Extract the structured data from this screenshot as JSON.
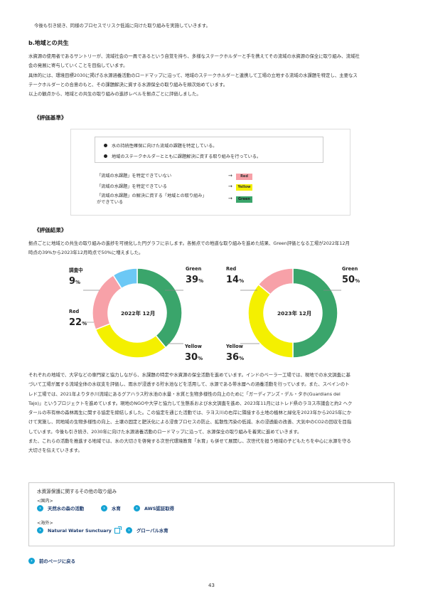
{
  "intro_text": "今後も引き続き、同様のプロセスでリスク低減に向けた取り組みを実施していきます。",
  "section_title": "b.地域との共生",
  "section_paragraph": [
    "水資源の使用者であるサントリーが、流域社会の一員であるという自覚を持ち、多様なステークホルダーと手を携えてその流域の水資源の保全に取り組み、流域社",
    "会の発展に寄与していくことを目指しています。",
    "具体的には、環境目標2030に掲げる水源涵養活動のロードマップに沿って、地域のステークホルダーと連携して工場の立地する流域の水課題を特定し、主要なス",
    "テークホルダーとの合意のもと、その課題解決に資する水源保全の取り組みを順次始めています。",
    "以上の観点から、地域との共生の取り組みの進捗レベルを拠点ごとに評価しました。"
  ],
  "criteria": {
    "heading": "《評価基準》",
    "bullets": [
      "水の持続性確保に向けた流域の課題を特定している。",
      "地域のステークホルダーとともに課題解決に資する取り組みを行っている。"
    ],
    "levels": [
      {
        "text": "「流域の水課題」を特定できていない",
        "arrow": "→",
        "badge": "Red",
        "color": "#f7a1a8"
      },
      {
        "text": "「流域の水課題」を特定できている",
        "arrow": "→",
        "badge": "Yellow",
        "color": "#f4f000"
      },
      {
        "text_line1": "「流域の水課題」の解決に資する「地域との取り組み」",
        "text_line2": "ができている",
        "arrow": "→",
        "badge": "Green",
        "color": "#3aa56b"
      }
    ]
  },
  "results": {
    "heading": "《評価結果》",
    "paragraph": [
      "拠点ごとに地域との共生の取り組みの進捗を可視化した円グラフに示します。各拠点での地道な取り組みを進めた結果、Green評価となる工場が2022年12月",
      "時点の39%から2023年12月時点で50%に増えました。"
    ]
  },
  "chart_data": [
    {
      "type": "pie",
      "title": "2022年 12月",
      "categories": [
        "Green",
        "Yellow",
        "Red",
        "調査中"
      ],
      "values": [
        39,
        30,
        22,
        9
      ],
      "value_labels": [
        "39",
        "30",
        "22",
        "9"
      ],
      "unit": "%",
      "colors": [
        "#3aa56b",
        "#f4f000",
        "#f7a1a8",
        "#6cc8f5"
      ]
    },
    {
      "type": "pie",
      "title": "2023年 12月",
      "categories": [
        "Green",
        "Yellow",
        "Red"
      ],
      "values": [
        50,
        36,
        14
      ],
      "value_labels": [
        "50",
        "36",
        "14"
      ],
      "unit": "%",
      "colors": [
        "#3aa56b",
        "#f4f000",
        "#f7a1a8"
      ]
    }
  ],
  "body_paragraph": [
    "それぞれの地域で、大学などの専門家と協力しながら、水課題の特定や水資源の保全活動を進めています。インドのベーラー工場では、現地での水文調査に基",
    "づいて工場が属する流域全体の水収支を評価し、雨水が浸透する貯水池などを活用して、水源である帯水層への涵養活動を行っています。また、スペインのト",
    "レド工場では、2021年よりタホ川流域にあるグアハラス貯水池の水量・水質と生物多様性の向上のために「ガーディアンズ・デル・タホ(Guardians del",
    "Tajo)」というプロジェクトを進めています。現地のNGOや大学と協力して生態系および水文調査を進め、2023年11月にはトレド県のラヨス市議会と約2 ヘク",
    "タールの市有林の森林再生に関する協定を締結しました。この協定を通じた活動では、ラヨス川の右岸に隣接する土地の植林と緑化を2023年から2025年にか",
    "けて実施し、同地域の生物多様性の向上、土壌の固定と肥沃化による浸食プロセスの防止、拡散性汚染の低減、水の浸透能の改善、大気中のCO2の回収を目指",
    "しています。今後も引き続き、2030年に向けた水源涵養活動のロードマップに沿って、水源保全の取り組みを着実に進めていきます。",
    "また、これらの活動を推進する地域では、水の大切さを啓発する次世代環境教育「水育」も併せて展開し、次世代を担う地域の子どもたちを中心に水源を守る",
    "大切さを伝えていきます。"
  ],
  "related": {
    "title": "水資源保護に関するその他の取り組み",
    "domestic_label": "<国内>",
    "domestic_links": [
      "天然水の森の活動",
      "水育",
      "AWS認証取得"
    ],
    "overseas_label": "<海外>",
    "overseas_links": [
      "Natural Water Sunctuary",
      "グローバル水育"
    ]
  },
  "back_link": "前のページに戻る",
  "page_number": "43",
  "accent_color": "#14a3d4"
}
